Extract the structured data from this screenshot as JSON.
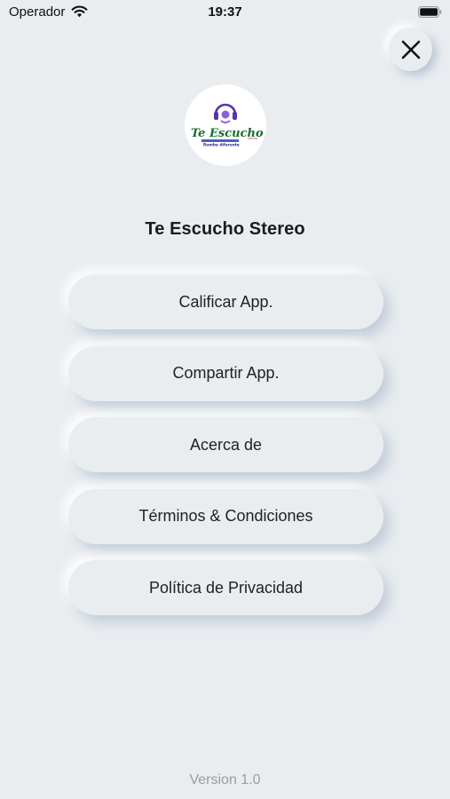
{
  "status_bar": {
    "carrier": "Operador",
    "time": "19:37",
    "wifi_icon": "wifi-icon",
    "battery_icon": "battery-icon"
  },
  "close_icon": "close-icon",
  "logo": {
    "text_main": "Te Escucho",
    "text_small": "Rumba diferente",
    "text_tag": "stereo"
  },
  "app_name": "Te Escucho Stereo",
  "menu": {
    "items": [
      {
        "label": "Calificar App."
      },
      {
        "label": "Compartir App."
      },
      {
        "label": "Acerca de"
      },
      {
        "label": "Términos & Condiciones"
      },
      {
        "label": "Política de Privacidad"
      }
    ]
  },
  "version": "Version 1.0",
  "colors": {
    "background": "#e9edf0",
    "text": "#222222",
    "version_text": "#9a9ea4"
  }
}
